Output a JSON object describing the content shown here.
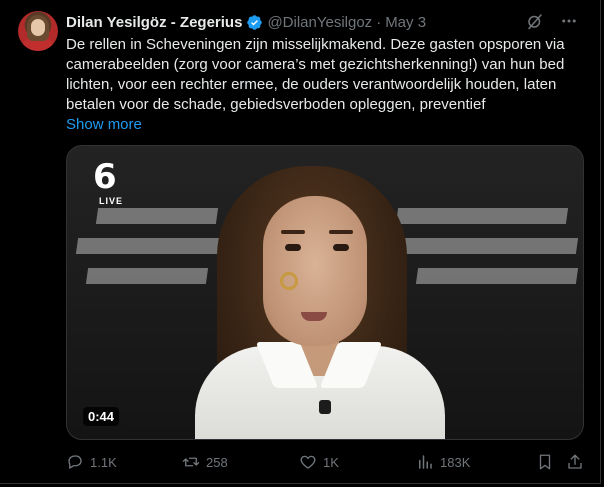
{
  "tweet": {
    "author_name": "Dilan Yesilgöz - Zegerius",
    "handle": "@DilanYesilgoz",
    "separator": "·",
    "date": "May 3",
    "text": "De rellen in Scheveningen zijn misselijkmakend. Deze gasten opsporen via camerabeelden (zorg voor camera’s met gezichtsherkenning!) van hun bed lichten, voor een rechter ermee, de ouders verantwoordelijk houden, laten betalen voor de schade, gebiedsverboden opleggen, preventief",
    "show_more": "Show more"
  },
  "media": {
    "channel_logo": "6",
    "live_label": "LIVE",
    "duration": "0:44"
  },
  "actions": {
    "replies": "1.1K",
    "reposts": "258",
    "likes": "1K",
    "views": "183K"
  },
  "icons": {
    "verified": "verified-badge-icon",
    "grok": "grok-icon",
    "more": "more-icon",
    "reply": "reply-icon",
    "repost": "repost-icon",
    "like": "like-icon",
    "views": "views-icon",
    "bookmark": "bookmark-icon",
    "share": "share-icon"
  },
  "colors": {
    "background": "#000000",
    "text": "#e7e9ea",
    "secondary": "#71767b",
    "accent": "#1d9bf0",
    "border": "#2f3336"
  }
}
